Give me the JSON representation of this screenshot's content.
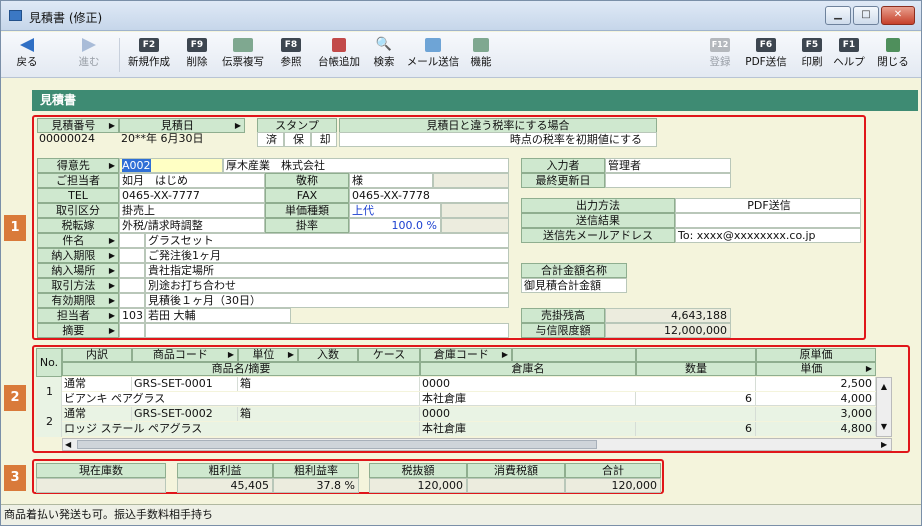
{
  "window": {
    "title": "見積書 (修正)"
  },
  "toolbar": {
    "back": "戻る",
    "forward": "進む",
    "new": "新規作成",
    "delete": "削除",
    "copy": "伝票複写",
    "reference": "参照",
    "add_ledger": "台帳追加",
    "search": "検索",
    "mail": "メール送信",
    "function": "機能",
    "register": "登録",
    "pdf": "PDF送信",
    "print": "印刷",
    "help": "ヘルプ",
    "close": "閉じる",
    "keys": {
      "new": "F2",
      "delete": "F9",
      "reference": "F8",
      "register": "F12",
      "pdf": "F6",
      "print": "F5",
      "help": "F1"
    }
  },
  "section_title": "見積書",
  "header": {
    "estimate_no_label": "見積番号",
    "estimate_no": "00000024",
    "date_label": "見積日",
    "date": "20**年 6月30日",
    "stamp_label": "スタンプ",
    "stamps": [
      "済",
      "保",
      "却"
    ],
    "tax_label": "見積日と違う税率にする場合",
    "tax_value": "時点の税率を初期値にする"
  },
  "customer": {
    "customer_label": "得意先",
    "customer_code": "A002",
    "customer_name": "厚木産業　株式会社",
    "contact_label": "ご担当者",
    "contact": "如月　はじめ",
    "honorific_label": "敬称",
    "honorific": "様",
    "tel_label": "TEL",
    "tel": "0465-XX-7777",
    "fax_label": "FAX",
    "fax": "0465-XX-7778",
    "trade_label": "取引区分",
    "trade": "掛売上",
    "price_type_label": "単価種類",
    "price_type": "上代",
    "tax_mode_label": "税転嫁",
    "tax_mode": "外税/請求時調整",
    "rate_label": "掛率",
    "rate": "100.0 %",
    "subject_label": "件名",
    "subject": "グラスセット",
    "delivery_label": "納入期限",
    "delivery": "ご発注後1ヶ月",
    "place_label": "納入場所",
    "place": "貴社指定場所",
    "method_label": "取引方法",
    "method": "別途お打ち合わせ",
    "valid_label": "有効期限",
    "valid": "見積後１ヶ月（30日）",
    "staff_label": "担当者",
    "staff_code": "103",
    "staff": "若田 大輔",
    "memo_label": "摘要",
    "memo": ""
  },
  "right_panel": {
    "entry_label": "入力者",
    "entry": "管理者",
    "updated_label": "最終更新日",
    "updated": "",
    "output_label": "出力方法",
    "output": "PDF送信",
    "result_label": "送信結果",
    "result": "",
    "mail_label": "送信先メールアドレス",
    "mail": "To: xxxx@xxxxxxxx.co.jp",
    "total_name_label": "合計金額名称",
    "total_name": "御見積合計金額",
    "ar_label": "売掛残高",
    "ar": "4,643,188",
    "credit_label": "与信限度額",
    "credit": "12,000,000"
  },
  "grid": {
    "no": "No.",
    "headers_top": [
      "内訳",
      "商品コード",
      "単位",
      "入数",
      "ケース",
      "倉庫コード",
      "原単価"
    ],
    "headers_bottom": [
      "商品名/摘要",
      "倉庫名",
      "数量",
      "単価"
    ],
    "rows": [
      {
        "no": "1",
        "type": "通常",
        "code": "GRS-SET-0001",
        "unit": "箱",
        "wh_code": "0000",
        "cost": "2,500",
        "name": "ビアンキ ペアグラス",
        "wh_name": "本社倉庫",
        "qty": "6",
        "price": "4,000"
      },
      {
        "no": "2",
        "type": "通常",
        "code": "GRS-SET-0002",
        "unit": "箱",
        "wh_code": "0000",
        "cost": "3,000",
        "name": "ロッジ ステール ペアグラス",
        "wh_name": "本社倉庫",
        "qty": "6",
        "price": "4,800"
      }
    ]
  },
  "totals": {
    "stock_label": "現在庫数",
    "stock": "",
    "profit_label": "粗利益",
    "profit": "45,405",
    "margin_label": "粗利益率",
    "margin": "37.8 %",
    "net_label": "税抜額",
    "net": "120,000",
    "tax_label": "消費税額",
    "tax": "",
    "total_label": "合計",
    "total": "120,000"
  },
  "badges": [
    "1",
    "2",
    "3"
  ],
  "status": "商品着払い発送も可。振込手数料相手持ち",
  "colors": {
    "section": "#3e8b73",
    "label_bg": "#cfe8cf",
    "highlight": "#e0161a",
    "badge": "#d97a3a",
    "form_bg": "#f4f4dc"
  }
}
